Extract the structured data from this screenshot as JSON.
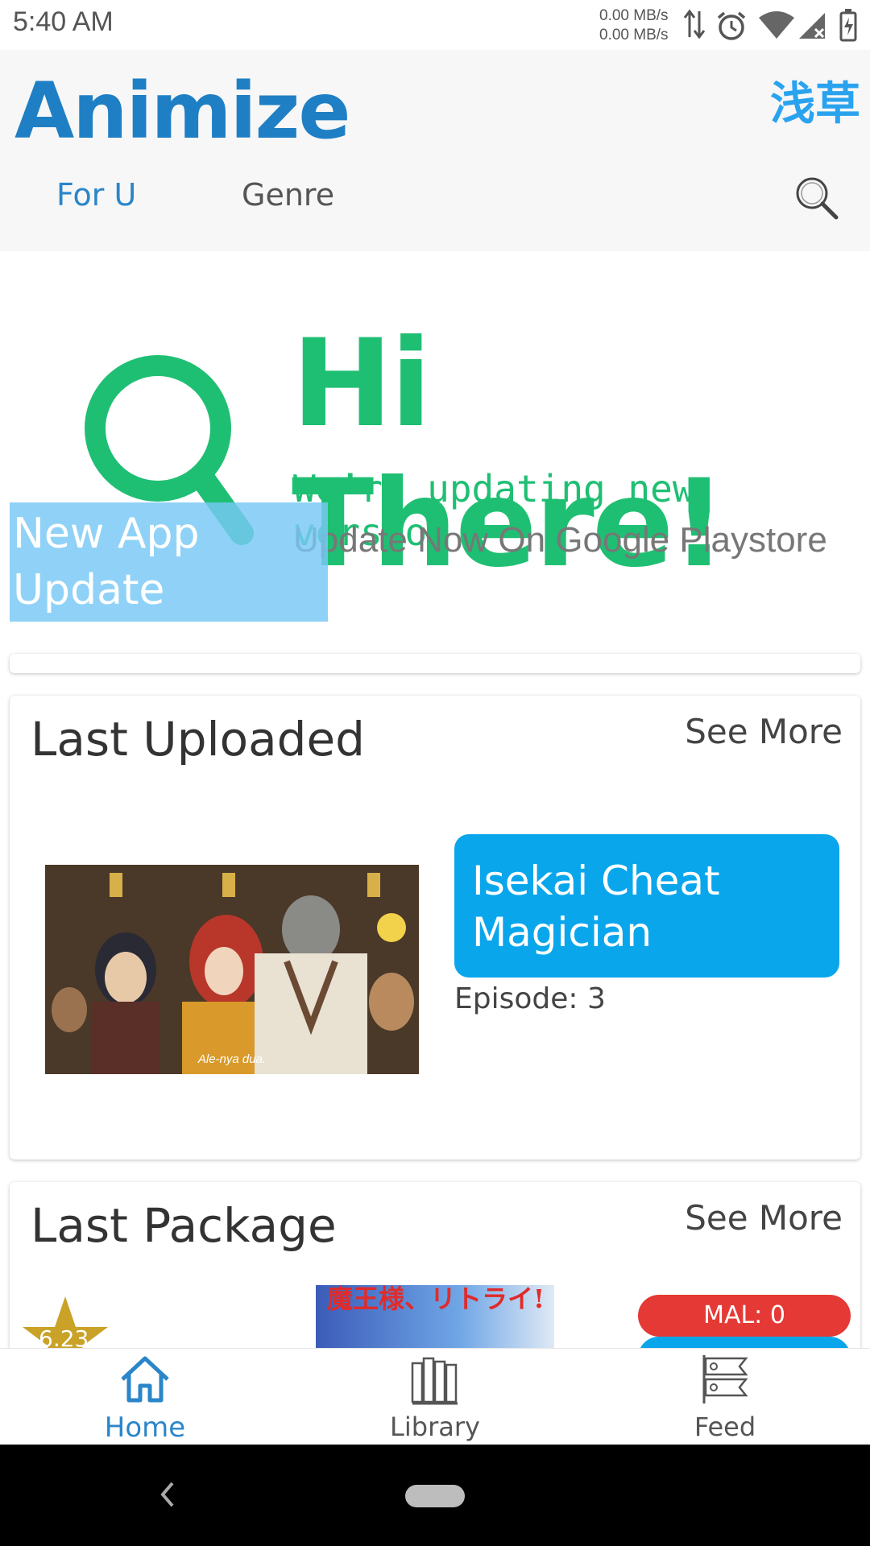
{
  "status_bar": {
    "time": "5:40 AM",
    "speed_up": "0.00 MB/s",
    "speed_down": "0.00 MB/s",
    "icons": [
      "data-transfer-icon",
      "alarm-icon",
      "wifi-icon",
      "cell-signal-icon",
      "battery-charging-icon"
    ]
  },
  "header": {
    "logo": "Animize",
    "kanji": "浅草",
    "tabs": [
      {
        "label": "For U",
        "active": true
      },
      {
        "label": "Genre",
        "active": false
      }
    ],
    "search_icon": "search-icon"
  },
  "banner": {
    "headline": "Hi There!",
    "subline": "We’re updating new version !",
    "cta": "Update Now On Google Playstore",
    "overlay": "New App Update"
  },
  "last_uploaded": {
    "title": "Last Uploaded",
    "see_more": "See More",
    "item": {
      "name": "Isekai Cheat Magician",
      "episode": "Episode: 3",
      "thumb_caption": "Ale-nya dua."
    }
  },
  "last_package": {
    "title": "Last Package",
    "see_more": "See More",
    "rating": "6.23",
    "mal": "MAL: 0",
    "poster_text": "魔王様、リトライ!"
  },
  "bottom_nav": [
    {
      "label": "Home",
      "icon": "home-icon",
      "active": true
    },
    {
      "label": "Library",
      "icon": "library-icon",
      "active": false
    },
    {
      "label": "Feed",
      "icon": "feed-icon",
      "active": false
    }
  ],
  "colors": {
    "accent": "#2a86c9",
    "banner_green": "#1fbf73",
    "pill_blue": "#0aa6ec",
    "mal_red": "#e53935",
    "star_gold": "#c9a227"
  }
}
